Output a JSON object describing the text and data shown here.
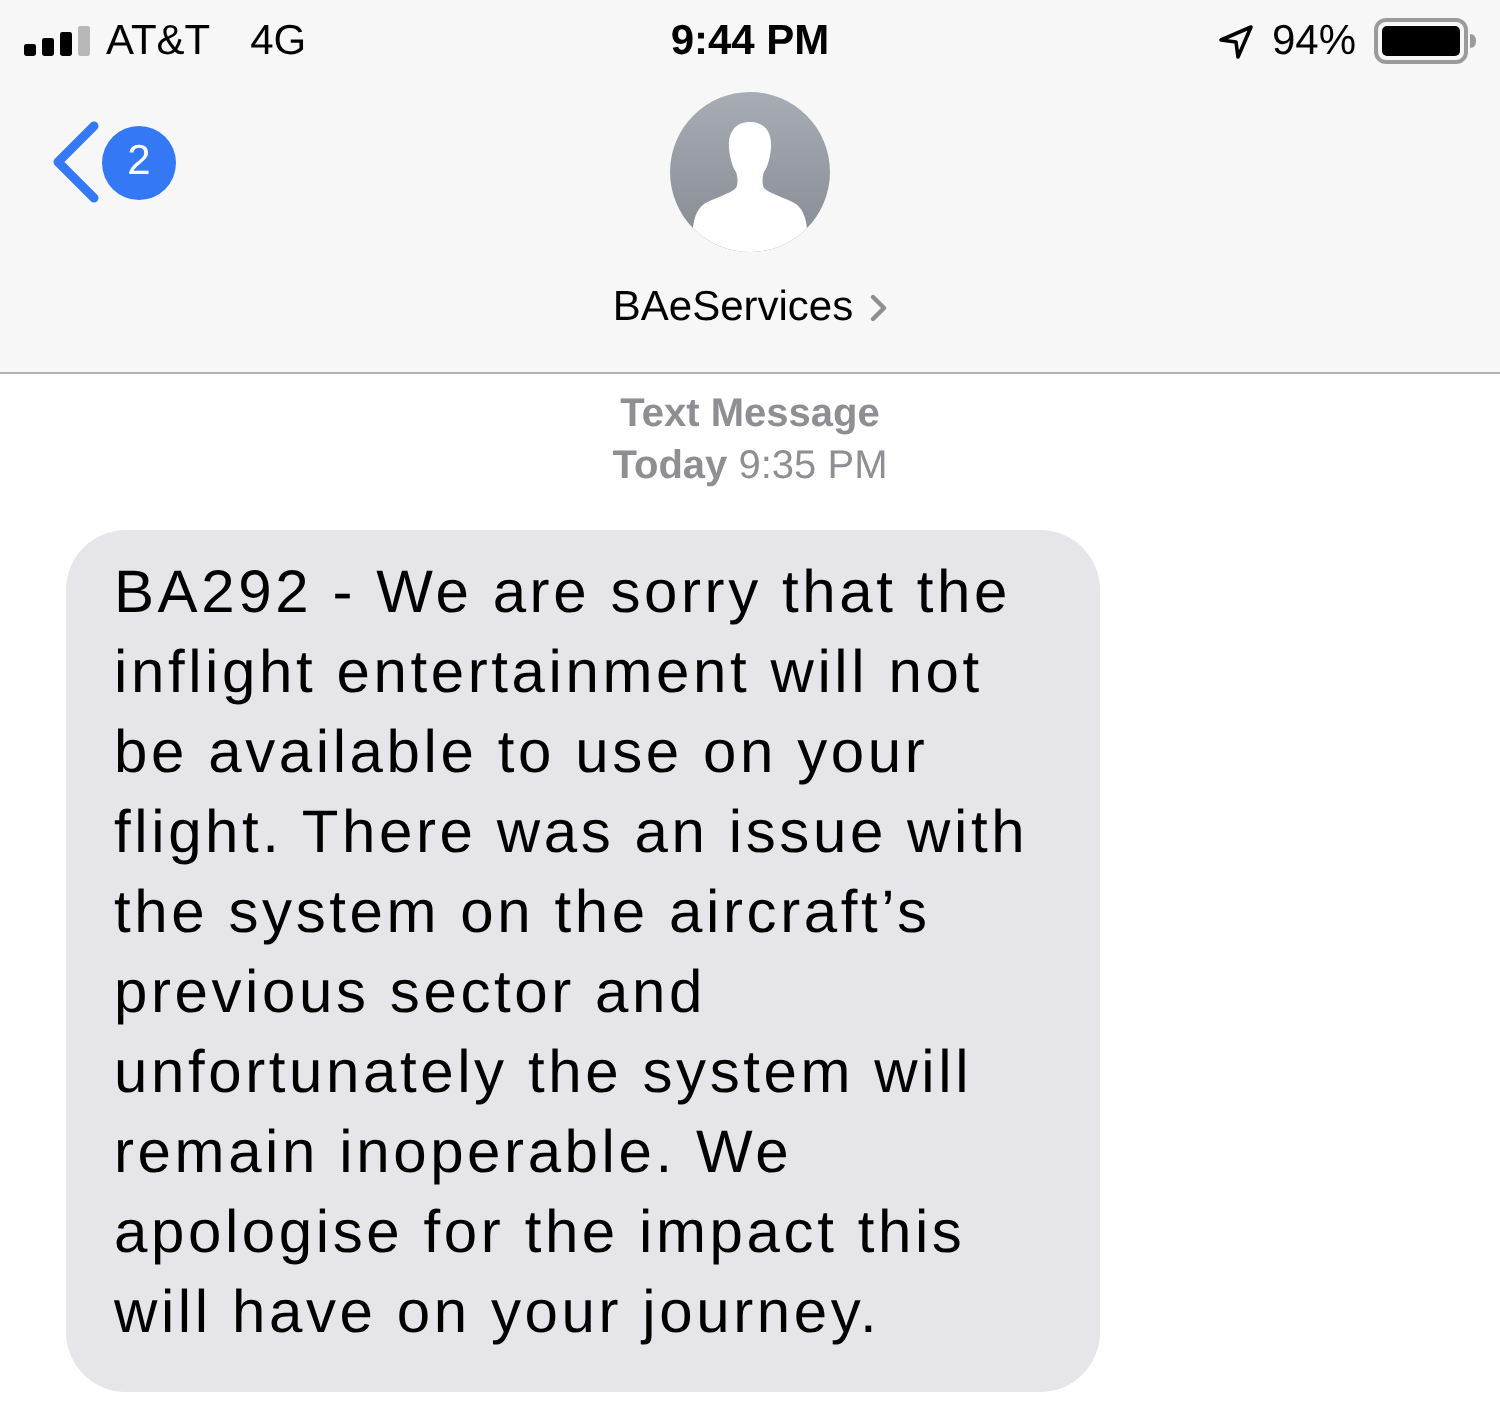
{
  "status_bar": {
    "carrier": "AT&T",
    "network": "4G",
    "time": "9:44 PM",
    "battery": "94%"
  },
  "header": {
    "unread_count": "2",
    "contact_name": "BAeServices"
  },
  "thread": {
    "service": "Text Message",
    "timestamp": "**Today** 9:35 PM"
  },
  "messages": [
    {
      "kind": "incoming",
      "text": "BA292 - We are sorry that the inflight entertainment will not be available to use on your flight. There was an issue with the system on the aircraft’s previous sector and unfortunately the system will remain inoperable. We apologise for the impact this will have on your journey."
    }
  ]
}
